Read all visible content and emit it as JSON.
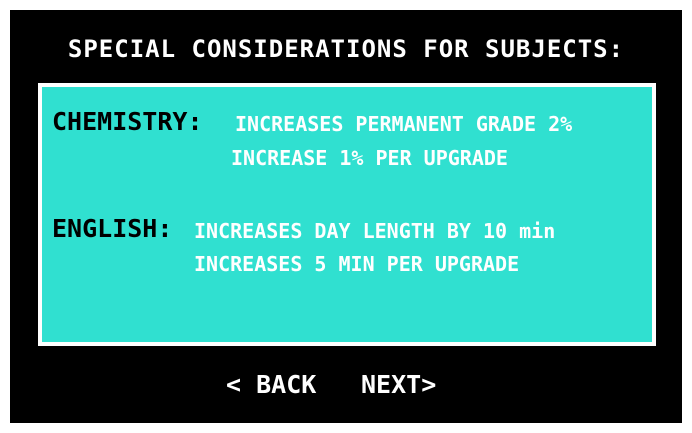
{
  "title": "SPECIAL CONSIDERATIONS FOR SUBJECTS:",
  "subjects": [
    {
      "name": "CHEMISTRY:",
      "line1": "INCREASES PERMANENT GRADE 2%",
      "line2": "INCREASE 1% PER UPGRADE"
    },
    {
      "name": "ENGLISH:",
      "line1": "INCREASES DAY LENGTH BY 10 min",
      "line2": "INCREASES 5 MIN PER UPGRADE"
    }
  ],
  "nav": {
    "back_label": "< BACK",
    "next_label": "NEXT>"
  },
  "colors": {
    "background": "#000000",
    "panel": "#30e0d0",
    "panel_border": "#ffffff",
    "label_text": "#000000",
    "desc_text": "#ffffff"
  }
}
